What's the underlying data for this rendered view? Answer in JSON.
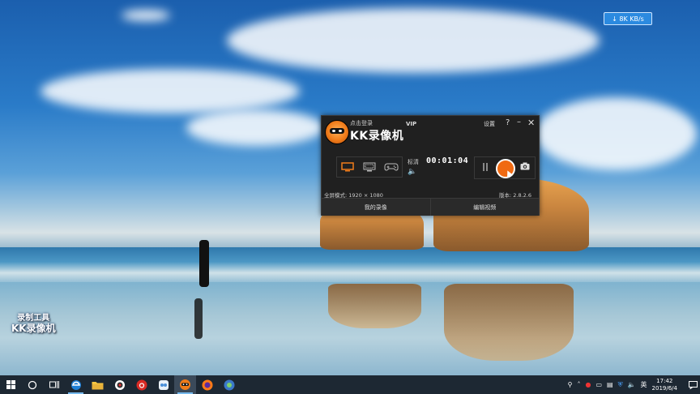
{
  "desktop": {
    "watermark": {
      "line1": "录制工具",
      "line2": "KK录像机"
    },
    "net_badge": "↓ 8K KB/s"
  },
  "kk_window": {
    "login_label": "点击登录",
    "brand": "KK录像机",
    "vip_label": "VIP",
    "settings_label": "设置",
    "help_label": "?",
    "quality_label": "标清",
    "timer": "00:01:04",
    "mode_info": "全屏模式: 1920 × 1080",
    "version": "版本: 2.8.2.6",
    "my_recordings_label": "我的录像",
    "edit_video_label": "编辑视频",
    "record_button_color": "#f06a12"
  },
  "taskbar": {
    "clock_time": "17:42",
    "clock_date": "2019/6/4",
    "ime_label": "英",
    "items": [
      "start",
      "search",
      "task-view",
      "edge",
      "file-explorer",
      "chrome-like",
      "netease-music",
      "app",
      "kk-recorder",
      "firefox",
      "browser"
    ]
  }
}
